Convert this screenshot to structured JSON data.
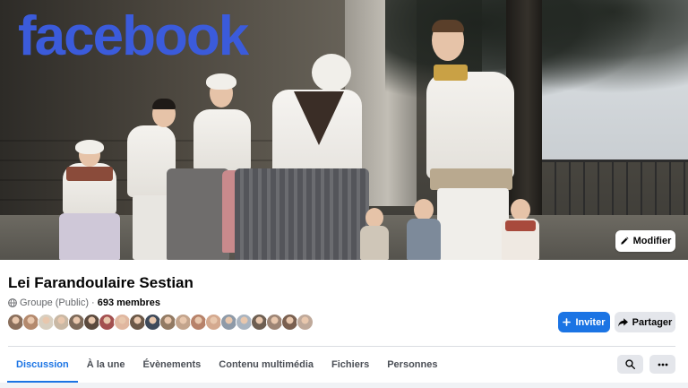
{
  "cover": {
    "logo_text": "facebook",
    "edit_button_label": "Modifier"
  },
  "group": {
    "name": "Lei Farandoulaire Sestian",
    "privacy": "Groupe (Public)",
    "separator": "·",
    "member_count": "693 membres"
  },
  "actions": {
    "invite_label": "Inviter",
    "share_label": "Partager"
  },
  "tabs": [
    {
      "label": "Discussion",
      "active": true
    },
    {
      "label": "À la une",
      "active": false
    },
    {
      "label": "Évènements",
      "active": false
    },
    {
      "label": "Contenu multimédia",
      "active": false
    },
    {
      "label": "Fichiers",
      "active": false
    },
    {
      "label": "Personnes",
      "active": false
    }
  ],
  "icons": {
    "edit": "pencil-icon",
    "privacy": "globe-icon",
    "invite": "plus-icon",
    "share": "share-arrow-icon",
    "search": "search-icon",
    "more": "more-dots-icon"
  },
  "colors": {
    "accent": "#1b74e4",
    "logo": "#3b5bdb",
    "secondary_button": "#e4e6eb"
  },
  "member_avatars": [
    "#8a6f5c",
    "#b48a6e",
    "#d8cfc0",
    "#c9b8a4",
    "#7d6a5a",
    "#5b4a3e",
    "#a35050",
    "#e0b7a0",
    "#6b5848",
    "#3e4a5a",
    "#927a63",
    "#c3a48c",
    "#b7826a",
    "#d4a98f",
    "#8e9aa8",
    "#a9b4c0",
    "#6e5f52",
    "#9d8575",
    "#7a6050",
    "#bfa99a"
  ]
}
